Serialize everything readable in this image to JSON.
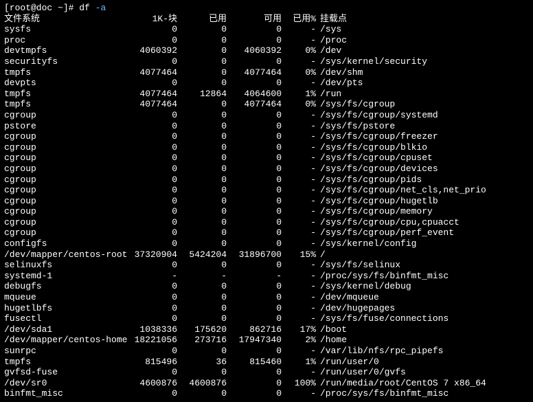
{
  "prompt": {
    "user_host": "[root@doc ~]#",
    "cmd": "df",
    "arg": "-a"
  },
  "headers": {
    "fs": "文件系统",
    "blocks": "1K-块",
    "used": "已用",
    "avail": "可用",
    "pct": "已用%",
    "mount": "挂载点"
  },
  "rows": [
    {
      "fs": "sysfs",
      "blocks": "0",
      "used": "0",
      "avail": "0",
      "pct": "-",
      "mount": "/sys"
    },
    {
      "fs": "proc",
      "blocks": "0",
      "used": "0",
      "avail": "0",
      "pct": "-",
      "mount": "/proc"
    },
    {
      "fs": "devtmpfs",
      "blocks": "4060392",
      "used": "0",
      "avail": "4060392",
      "pct": "0%",
      "mount": "/dev"
    },
    {
      "fs": "securityfs",
      "blocks": "0",
      "used": "0",
      "avail": "0",
      "pct": "-",
      "mount": "/sys/kernel/security"
    },
    {
      "fs": "tmpfs",
      "blocks": "4077464",
      "used": "0",
      "avail": "4077464",
      "pct": "0%",
      "mount": "/dev/shm"
    },
    {
      "fs": "devpts",
      "blocks": "0",
      "used": "0",
      "avail": "0",
      "pct": "-",
      "mount": "/dev/pts"
    },
    {
      "fs": "tmpfs",
      "blocks": "4077464",
      "used": "12864",
      "avail": "4064600",
      "pct": "1%",
      "mount": "/run"
    },
    {
      "fs": "tmpfs",
      "blocks": "4077464",
      "used": "0",
      "avail": "4077464",
      "pct": "0%",
      "mount": "/sys/fs/cgroup"
    },
    {
      "fs": "cgroup",
      "blocks": "0",
      "used": "0",
      "avail": "0",
      "pct": "-",
      "mount": "/sys/fs/cgroup/systemd"
    },
    {
      "fs": "pstore",
      "blocks": "0",
      "used": "0",
      "avail": "0",
      "pct": "-",
      "mount": "/sys/fs/pstore"
    },
    {
      "fs": "cgroup",
      "blocks": "0",
      "used": "0",
      "avail": "0",
      "pct": "-",
      "mount": "/sys/fs/cgroup/freezer"
    },
    {
      "fs": "cgroup",
      "blocks": "0",
      "used": "0",
      "avail": "0",
      "pct": "-",
      "mount": "/sys/fs/cgroup/blkio"
    },
    {
      "fs": "cgroup",
      "blocks": "0",
      "used": "0",
      "avail": "0",
      "pct": "-",
      "mount": "/sys/fs/cgroup/cpuset"
    },
    {
      "fs": "cgroup",
      "blocks": "0",
      "used": "0",
      "avail": "0",
      "pct": "-",
      "mount": "/sys/fs/cgroup/devices"
    },
    {
      "fs": "cgroup",
      "blocks": "0",
      "used": "0",
      "avail": "0",
      "pct": "-",
      "mount": "/sys/fs/cgroup/pids"
    },
    {
      "fs": "cgroup",
      "blocks": "0",
      "used": "0",
      "avail": "0",
      "pct": "-",
      "mount": "/sys/fs/cgroup/net_cls,net_prio"
    },
    {
      "fs": "cgroup",
      "blocks": "0",
      "used": "0",
      "avail": "0",
      "pct": "-",
      "mount": "/sys/fs/cgroup/hugetlb"
    },
    {
      "fs": "cgroup",
      "blocks": "0",
      "used": "0",
      "avail": "0",
      "pct": "-",
      "mount": "/sys/fs/cgroup/memory"
    },
    {
      "fs": "cgroup",
      "blocks": "0",
      "used": "0",
      "avail": "0",
      "pct": "-",
      "mount": "/sys/fs/cgroup/cpu,cpuacct"
    },
    {
      "fs": "cgroup",
      "blocks": "0",
      "used": "0",
      "avail": "0",
      "pct": "-",
      "mount": "/sys/fs/cgroup/perf_event"
    },
    {
      "fs": "configfs",
      "blocks": "0",
      "used": "0",
      "avail": "0",
      "pct": "-",
      "mount": "/sys/kernel/config"
    },
    {
      "fs": "/dev/mapper/centos-root",
      "blocks": "37320904",
      "used": "5424204",
      "avail": "31896700",
      "pct": "15%",
      "mount": "/"
    },
    {
      "fs": "selinuxfs",
      "blocks": "0",
      "used": "0",
      "avail": "0",
      "pct": "-",
      "mount": "/sys/fs/selinux"
    },
    {
      "fs": "systemd-1",
      "blocks": "-",
      "used": "-",
      "avail": "-",
      "pct": "-",
      "mount": "/proc/sys/fs/binfmt_misc"
    },
    {
      "fs": "debugfs",
      "blocks": "0",
      "used": "0",
      "avail": "0",
      "pct": "-",
      "mount": "/sys/kernel/debug"
    },
    {
      "fs": "mqueue",
      "blocks": "0",
      "used": "0",
      "avail": "0",
      "pct": "-",
      "mount": "/dev/mqueue"
    },
    {
      "fs": "hugetlbfs",
      "blocks": "0",
      "used": "0",
      "avail": "0",
      "pct": "-",
      "mount": "/dev/hugepages"
    },
    {
      "fs": "fusectl",
      "blocks": "0",
      "used": "0",
      "avail": "0",
      "pct": "-",
      "mount": "/sys/fs/fuse/connections"
    },
    {
      "fs": "/dev/sda1",
      "blocks": "1038336",
      "used": "175620",
      "avail": "862716",
      "pct": "17%",
      "mount": "/boot"
    },
    {
      "fs": "/dev/mapper/centos-home",
      "blocks": "18221056",
      "used": "273716",
      "avail": "17947340",
      "pct": "2%",
      "mount": "/home"
    },
    {
      "fs": "sunrpc",
      "blocks": "0",
      "used": "0",
      "avail": "0",
      "pct": "-",
      "mount": "/var/lib/nfs/rpc_pipefs"
    },
    {
      "fs": "tmpfs",
      "blocks": "815496",
      "used": "36",
      "avail": "815460",
      "pct": "1%",
      "mount": "/run/user/0"
    },
    {
      "fs": "gvfsd-fuse",
      "blocks": "0",
      "used": "0",
      "avail": "0",
      "pct": "-",
      "mount": "/run/user/0/gvfs"
    },
    {
      "fs": "/dev/sr0",
      "blocks": "4600876",
      "used": "4600876",
      "avail": "0",
      "pct": "100%",
      "mount": "/run/media/root/CentOS 7 x86_64"
    },
    {
      "fs": "binfmt_misc",
      "blocks": "0",
      "used": "0",
      "avail": "0",
      "pct": "-",
      "mount": "/proc/sys/fs/binfmt_misc"
    }
  ]
}
